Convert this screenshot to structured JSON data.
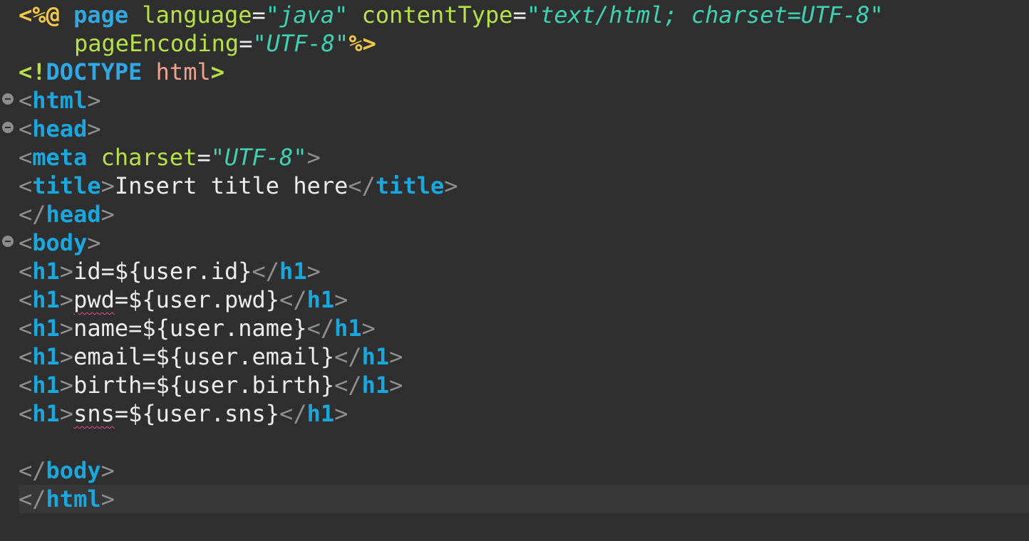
{
  "editor": {
    "directive": {
      "open": "<%@",
      "keyword": "page",
      "attr1_name": "language",
      "attr1_value": "java",
      "attr2_name": "contentType",
      "attr2_value": "text/html; charset=UTF-8",
      "attr3_name": "pageEncoding",
      "attr3_value": "UTF-8",
      "close": "%>"
    },
    "doctype": {
      "keyword": "DOCTYPE",
      "name": "html"
    },
    "tags": {
      "html": "html",
      "head": "head",
      "meta": "meta",
      "title": "title",
      "body": "body",
      "h1": "h1"
    },
    "meta_attr": {
      "name": "charset",
      "value": "UTF-8"
    },
    "title_text": "Insert title here",
    "h1_lines": [
      {
        "prefix": "",
        "misspelled": "id",
        "rest": "=${user.id}"
      },
      {
        "prefix": "",
        "misspelled": "pwd",
        "rest": "=${user.pwd}"
      },
      {
        "prefix": "",
        "misspelled": "name",
        "rest": "=${user.name}"
      },
      {
        "prefix": "",
        "misspelled": "email",
        "rest": "=${user.email}"
      },
      {
        "prefix": "",
        "misspelled": "birth",
        "rest": "=${user.birth}"
      },
      {
        "prefix": "",
        "misspelled": "sns",
        "rest": "=${user.sns}"
      }
    ]
  },
  "colors": {
    "background": "#2f2f2f",
    "tag": "#1aa7de",
    "attribute": "#b7e14a",
    "string": "#3fd1b2",
    "jsp_delimiter": "#f3c84a",
    "bracket": "#8f8f8f",
    "doctype_name": "#f0a28e",
    "spellcheck_underline": "#e0508e"
  }
}
